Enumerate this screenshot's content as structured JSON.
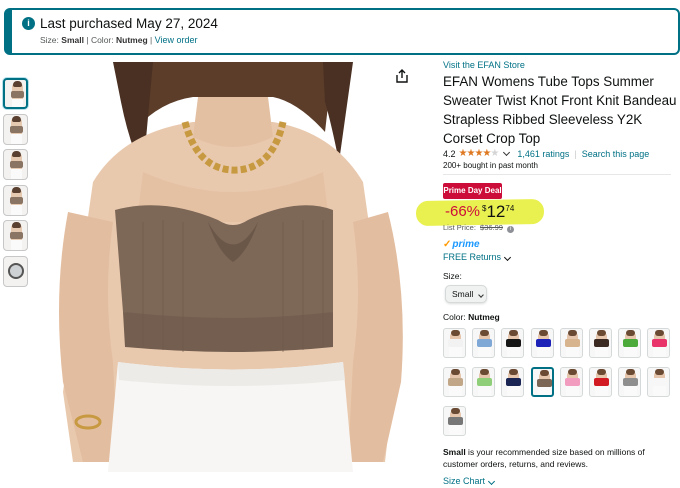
{
  "banner": {
    "title": "Last purchased May 27, 2024",
    "size_label": "Size:",
    "size_value": "Small",
    "color_label": "Color:",
    "color_value": "Nutmeg",
    "separator": "|",
    "view_order": "View order",
    "accent": "#007185"
  },
  "thumbnails": [
    {
      "kind": "image",
      "color": "#8a7463",
      "active": true
    },
    {
      "kind": "image",
      "color": "#8a7463",
      "active": false
    },
    {
      "kind": "image",
      "color": "#8a7463",
      "active": false
    },
    {
      "kind": "image",
      "color": "#8a7463",
      "active": false
    },
    {
      "kind": "image",
      "color": "#8a7463",
      "active": false
    },
    {
      "kind": "video",
      "active": false
    }
  ],
  "product": {
    "store_link": "Visit the EFAN Store",
    "title": "EFAN Womens Tube Tops Summer Sweater Twist Knot Front Knit Bandeau Strapless Ribbed Sleeveless Y2K Corset Crop Top",
    "rating": "4.2",
    "rating_value": 4.2,
    "ratings_count": "1,461 ratings",
    "rating_sep": "|",
    "search_page": "Search this page",
    "bought": "200+ bought in past month",
    "deal_badge": "Prime Day Deal",
    "discount": "-66%",
    "price_currency": "$",
    "price_whole": "12",
    "price_fraction": "74",
    "list_price_label": "List Price:",
    "list_price": "$36.99",
    "prime": "prime",
    "free_returns": "FREE Returns",
    "size_label": "Size:",
    "size_selected": "Small",
    "color_label": "Color:",
    "color_selected": "Nutmeg",
    "rec_bold": "Small",
    "rec_text": " is your recommended size based on millions of customer orders, returns, and reviews.",
    "size_chart": "Size Chart",
    "colors": {
      "deal": "#cc0c39",
      "highlight": "#e8f048",
      "link": "#007185",
      "star": "#de7921"
    }
  },
  "swatches": [
    {
      "color": "#f2f2f2",
      "selected": false
    },
    {
      "color": "#7fa8d6",
      "selected": false
    },
    {
      "color": "#161616",
      "selected": false
    },
    {
      "color": "#1c22b8",
      "selected": false
    },
    {
      "color": "#d7b48e",
      "selected": false
    },
    {
      "color": "#3a2a22",
      "selected": false
    },
    {
      "color": "#4caa3a",
      "selected": false
    },
    {
      "color": "#e8336b",
      "selected": false
    },
    {
      "color": "#c2a688",
      "selected": false
    },
    {
      "color": "#8fcf7a",
      "selected": false
    },
    {
      "color": "#1a2554",
      "selected": false
    },
    {
      "color": "#7b6656",
      "selected": true
    },
    {
      "color": "#f29cc0",
      "selected": false
    },
    {
      "color": "#d11a22",
      "selected": false
    },
    {
      "color": "#8e8e8e",
      "selected": false
    },
    {
      "color": "#f7f7f7",
      "selected": false
    },
    {
      "color": "#777777",
      "selected": false
    }
  ]
}
